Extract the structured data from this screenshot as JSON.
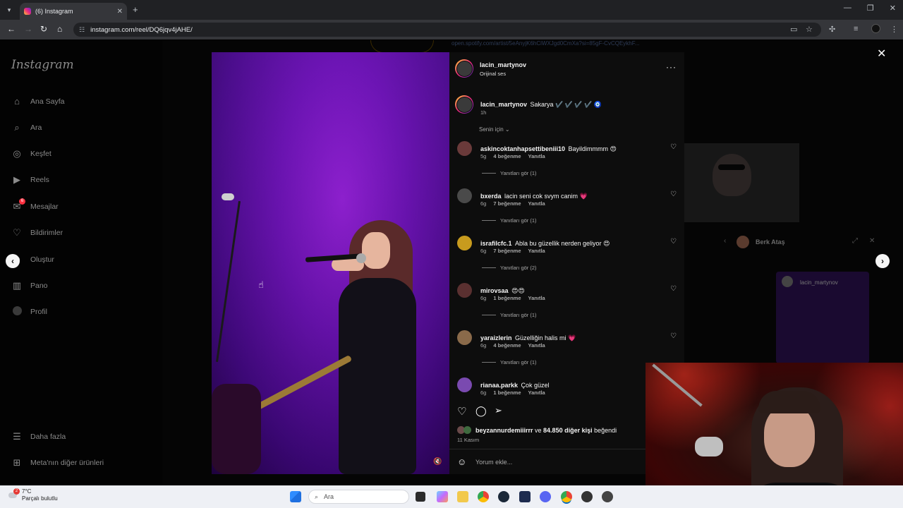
{
  "browser": {
    "tab_title": "(6) Instagram",
    "url": "instagram.com/reel/DQ6jqv4jAHE/"
  },
  "background": {
    "spotify_link": "open.spotify.com/artist/5eAnyjK6hCiWXJgd0CmXa?si=85gF-CvCQEykhF...",
    "mini_player_name": "Berk Ataş",
    "thumb_user": "lacin_martynov"
  },
  "sidebar": {
    "logo": "Instagram",
    "items": [
      {
        "label": "Ana Sayfa",
        "icon": "home-icon"
      },
      {
        "label": "Ara",
        "icon": "search-icon"
      },
      {
        "label": "Keşfet",
        "icon": "explore-icon"
      },
      {
        "label": "Reels",
        "icon": "reels-icon"
      },
      {
        "label": "Mesajlar",
        "icon": "messenger-icon",
        "badge": "6"
      },
      {
        "label": "Bildirimler",
        "icon": "heart-icon"
      },
      {
        "label": "Oluştur",
        "icon": "create-icon"
      },
      {
        "label": "Pano",
        "icon": "dashboard-icon"
      },
      {
        "label": "Profil",
        "icon": "profile-icon"
      }
    ],
    "more": "Daha fazla",
    "meta": "Meta'nın diğer ürünleri"
  },
  "post": {
    "author": "lacin_martynov",
    "audio": "Orijinal ses",
    "caption_user": "lacin_martynov",
    "caption_text": "Sakarya ✔️ ✔️ ✔️ ✔️ 🧿",
    "caption_time": "1h",
    "filter_label": "Senin için",
    "likes_user": "beyzannurdemiiirrr",
    "likes_text": " ve ",
    "likes_count": "84.850 diğer kişi",
    "likes_suffix": " beğendi",
    "date": "11 Kasım",
    "comment_placeholder": "Yorum ekle..."
  },
  "comments": [
    {
      "user": "askincoktanhapsettibeniii10",
      "text": "Bayildimmmm 😍",
      "time": "5g",
      "likes": "4 beğenme",
      "reply": "Yanıtla",
      "view_replies": "Yanıtları gör (1)"
    },
    {
      "user": "bxerda",
      "text": "lacin seni cok svym canim 💗",
      "time": "6g",
      "likes": "7 beğenme",
      "reply": "Yanıtla",
      "view_replies": "Yanıtları gör (1)"
    },
    {
      "user": "israfilcfc.1",
      "text": "Abla bu güzellik nerden geliyor 😍",
      "time": "6g",
      "likes": "7 beğenme",
      "reply": "Yanıtla",
      "view_replies": "Yanıtları gör (2)"
    },
    {
      "user": "mirovsaa",
      "text": "😍😍",
      "time": "6g",
      "likes": "1 beğenme",
      "reply": "Yanıtla",
      "view_replies": "Yanıtları gör (1)"
    },
    {
      "user": "yaraizlerin",
      "text": "Güzelliğin halis mi 💗",
      "time": "6g",
      "likes": "4 beğenme",
      "reply": "Yanıtla",
      "view_replies": "Yanıtları gör (1)"
    },
    {
      "user": "rianaa.parkk",
      "text": "Çok güzel",
      "time": "6g",
      "likes": "1 beğenme",
      "reply": "Yanıtla",
      "view_replies": ""
    }
  ],
  "taskbar": {
    "temperature": "7°C",
    "weather": "Parçalı bulutlu",
    "weather_badge": "2",
    "search_placeholder": "Ara"
  }
}
